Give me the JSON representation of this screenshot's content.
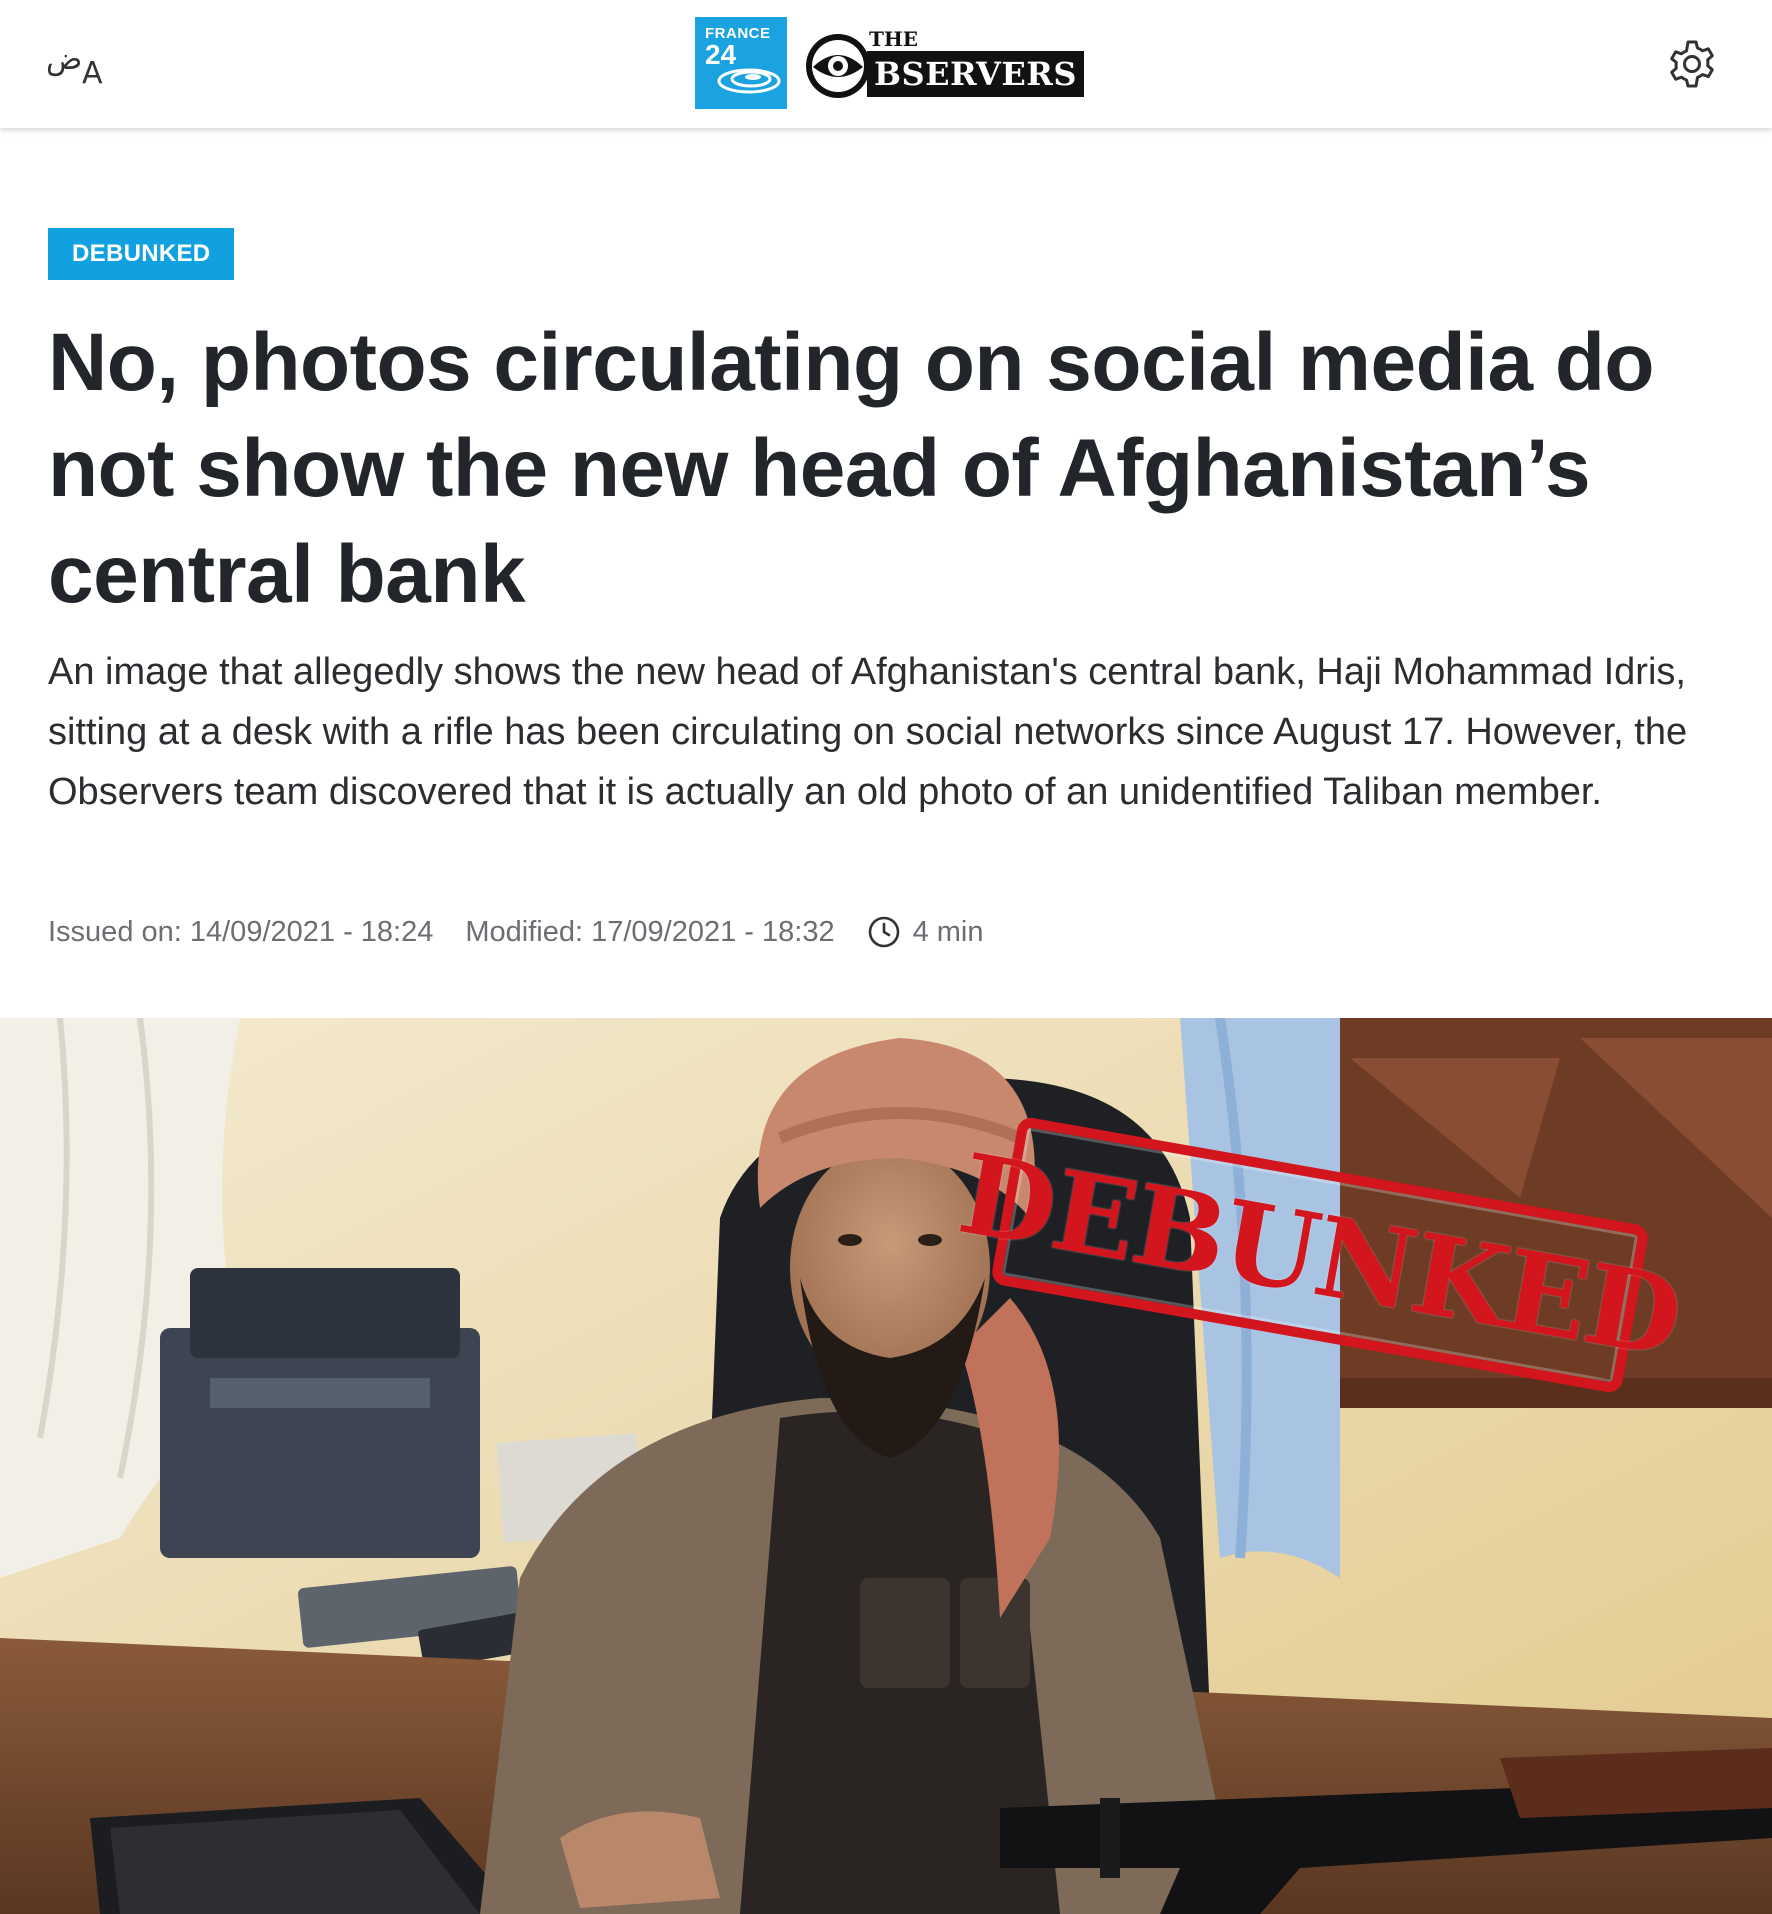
{
  "header": {
    "language_switch": {
      "arabic_glyph": "ض",
      "latin_glyph": "A"
    },
    "logo": {
      "france24_word": "FRANCE",
      "france24_number": "24",
      "observers_the": "THE",
      "observers_name": "BSERVERS"
    },
    "settings_icon": "gear-icon"
  },
  "article": {
    "badge": "DEBUNKED",
    "title": "No, photos circulating on social media do not show the new head of Afghanistan’s central bank",
    "lede": "An image that allegedly shows the new head of Afghanistan's central bank, Haji Mohammad Idris, sitting at a desk with a rifle has been circulating on social networks since August 17. However, the Observers team discovered that it is actually an old photo of an unidentified Taliban member.",
    "meta": {
      "issued": "Issued on: 14/09/2021 - 18:24",
      "modified": "Modified: 17/09/2021 - 18:32",
      "reading_time_icon": "clock-icon",
      "reading_time": "4 min"
    },
    "hero": {
      "stamp_text": "DEBUNKED"
    }
  },
  "colors": {
    "brand_blue": "#12a1e0",
    "title_text": "#22252a",
    "meta_text": "#6b6e73",
    "stamp_red": "#d3151d"
  }
}
